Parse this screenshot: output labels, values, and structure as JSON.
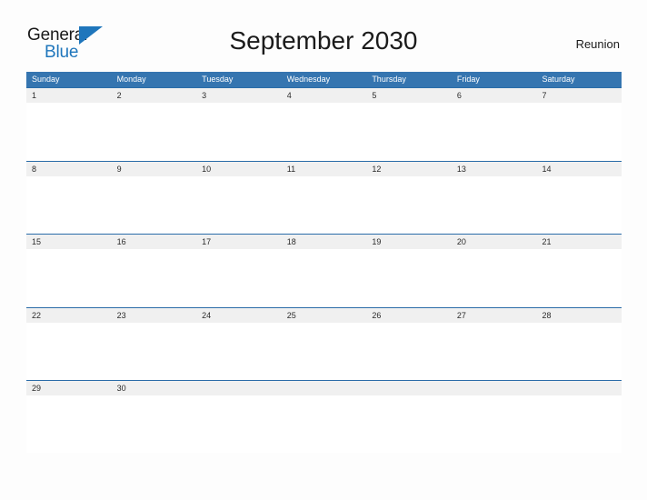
{
  "brand": {
    "name_part1": "General",
    "name_part2": "Blue",
    "flag_icon": "triangle-flag-icon",
    "color_primary": "#1f76bc",
    "color_text": "#1a1a1a"
  },
  "header": {
    "title": "September 2030",
    "location": "Reunion"
  },
  "calendar": {
    "header_color": "#3575b0",
    "separator_color": "#2a6ca8",
    "number_band_color": "#f0f0f0",
    "weekdays": [
      "Sunday",
      "Monday",
      "Tuesday",
      "Wednesday",
      "Thursday",
      "Friday",
      "Saturday"
    ],
    "weeks": [
      [
        "1",
        "2",
        "3",
        "4",
        "5",
        "6",
        "7"
      ],
      [
        "8",
        "9",
        "10",
        "11",
        "12",
        "13",
        "14"
      ],
      [
        "15",
        "16",
        "17",
        "18",
        "19",
        "20",
        "21"
      ],
      [
        "22",
        "23",
        "24",
        "25",
        "26",
        "27",
        "28"
      ],
      [
        "29",
        "30",
        "",
        "",
        "",
        "",
        ""
      ]
    ]
  }
}
